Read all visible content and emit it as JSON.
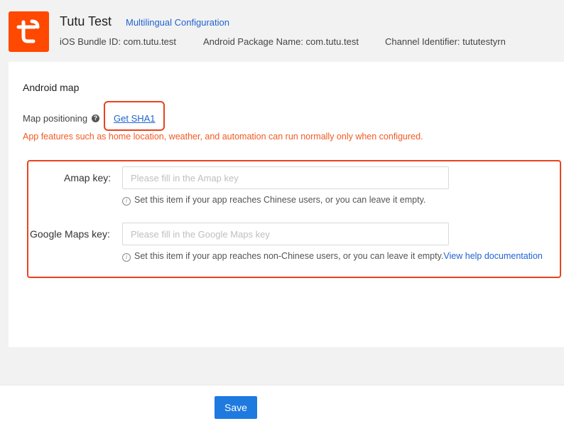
{
  "header": {
    "app_name": "Tutu Test",
    "multilingual_link": "Multilingual Configuration",
    "ios_bundle": "iOS Bundle ID: com.tutu.test",
    "android_package": "Android Package Name: com.tutu.test",
    "channel_identifier": "Channel Identifier: tututestyrn",
    "logo_icon": "tuya-logo-icon",
    "brand_color": "#ff4800"
  },
  "panel": {
    "section_title": "Android map",
    "map_positioning_label": "Map positioning",
    "help_icon": "?",
    "get_sha1_link": "Get SHA1",
    "warning": "App features such as home location, weather, and automation can run normally only when configured.",
    "amap": {
      "label": "Amap key:",
      "placeholder": "Please fill in the Amap key",
      "value": "",
      "hint": "Set this item if your app reaches Chinese users, or you can leave it empty."
    },
    "google": {
      "label": "Google Maps key:",
      "placeholder": "Please fill in the Google Maps key",
      "value": "",
      "hint": "Set this item if your app reaches non-Chinese users, or you can leave it empty.",
      "help_link": "View help documentation"
    },
    "info_icon": "i",
    "highlight_color": "#e8431e",
    "warning_color": "#f15a24"
  },
  "footer": {
    "save_label": "Save",
    "button_color": "#1f7ae0"
  }
}
